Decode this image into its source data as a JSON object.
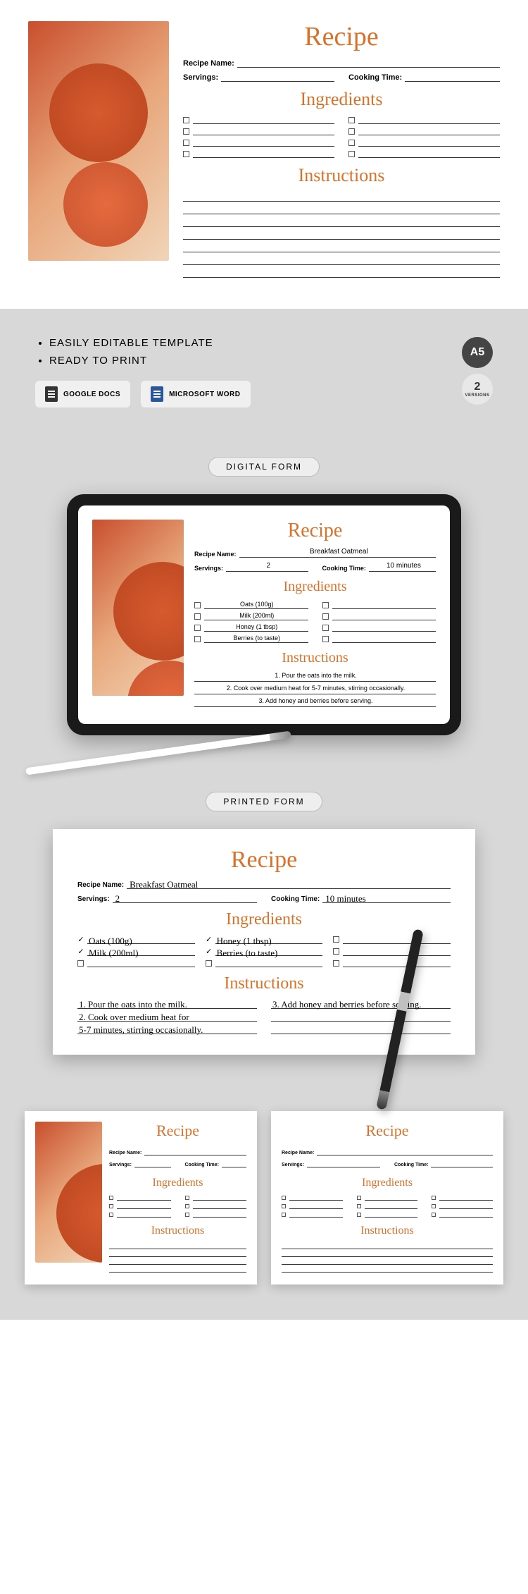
{
  "card": {
    "title": "Recipe",
    "recipe_name_label": "Recipe Name:",
    "servings_label": "Servings:",
    "cooking_time_label": "Cooking Time:",
    "ingredients_title": "Ingredients",
    "instructions_title": "Instructions"
  },
  "features": {
    "bullet1": "EASILY EDITABLE TEMPLATE",
    "bullet2": "READY TO PRINT",
    "google_docs": "GOOGLE DOCS",
    "microsoft_word": "MICROSOFT WORD",
    "size_badge": "A5",
    "versions_count": "2",
    "versions_label": "VERSIONS"
  },
  "digital": {
    "label": "DIGITAL FORM",
    "recipe_name": "Breakfast Oatmeal",
    "servings": "2",
    "cooking_time": "10 minutes",
    "ingredients": [
      "Oats (100g)",
      "Milk (200ml)",
      "Honey (1 tbsp)",
      "Berries (to taste)"
    ],
    "instructions": [
      "1. Pour the oats into the milk.",
      "2. Cook over medium heat for 5-7 minutes, stirring occasionally.",
      "3. Add honey and berries before serving."
    ]
  },
  "printed": {
    "label": "PRINTED FORM",
    "recipe_name": "Breakfast Oatmeal",
    "servings": "2",
    "cooking_time": "10 minutes",
    "ingredients": [
      "Oats (100g)",
      "Milk (200ml)",
      "Honey (1 tbsp)",
      "Berries (to taste)"
    ],
    "instructions_left": [
      "1. Pour the oats into the milk.",
      "2. Cook over medium heat for",
      "5-7 minutes, stirring occasionally."
    ],
    "instructions_right": [
      "3. Add honey and berries before serving."
    ]
  }
}
